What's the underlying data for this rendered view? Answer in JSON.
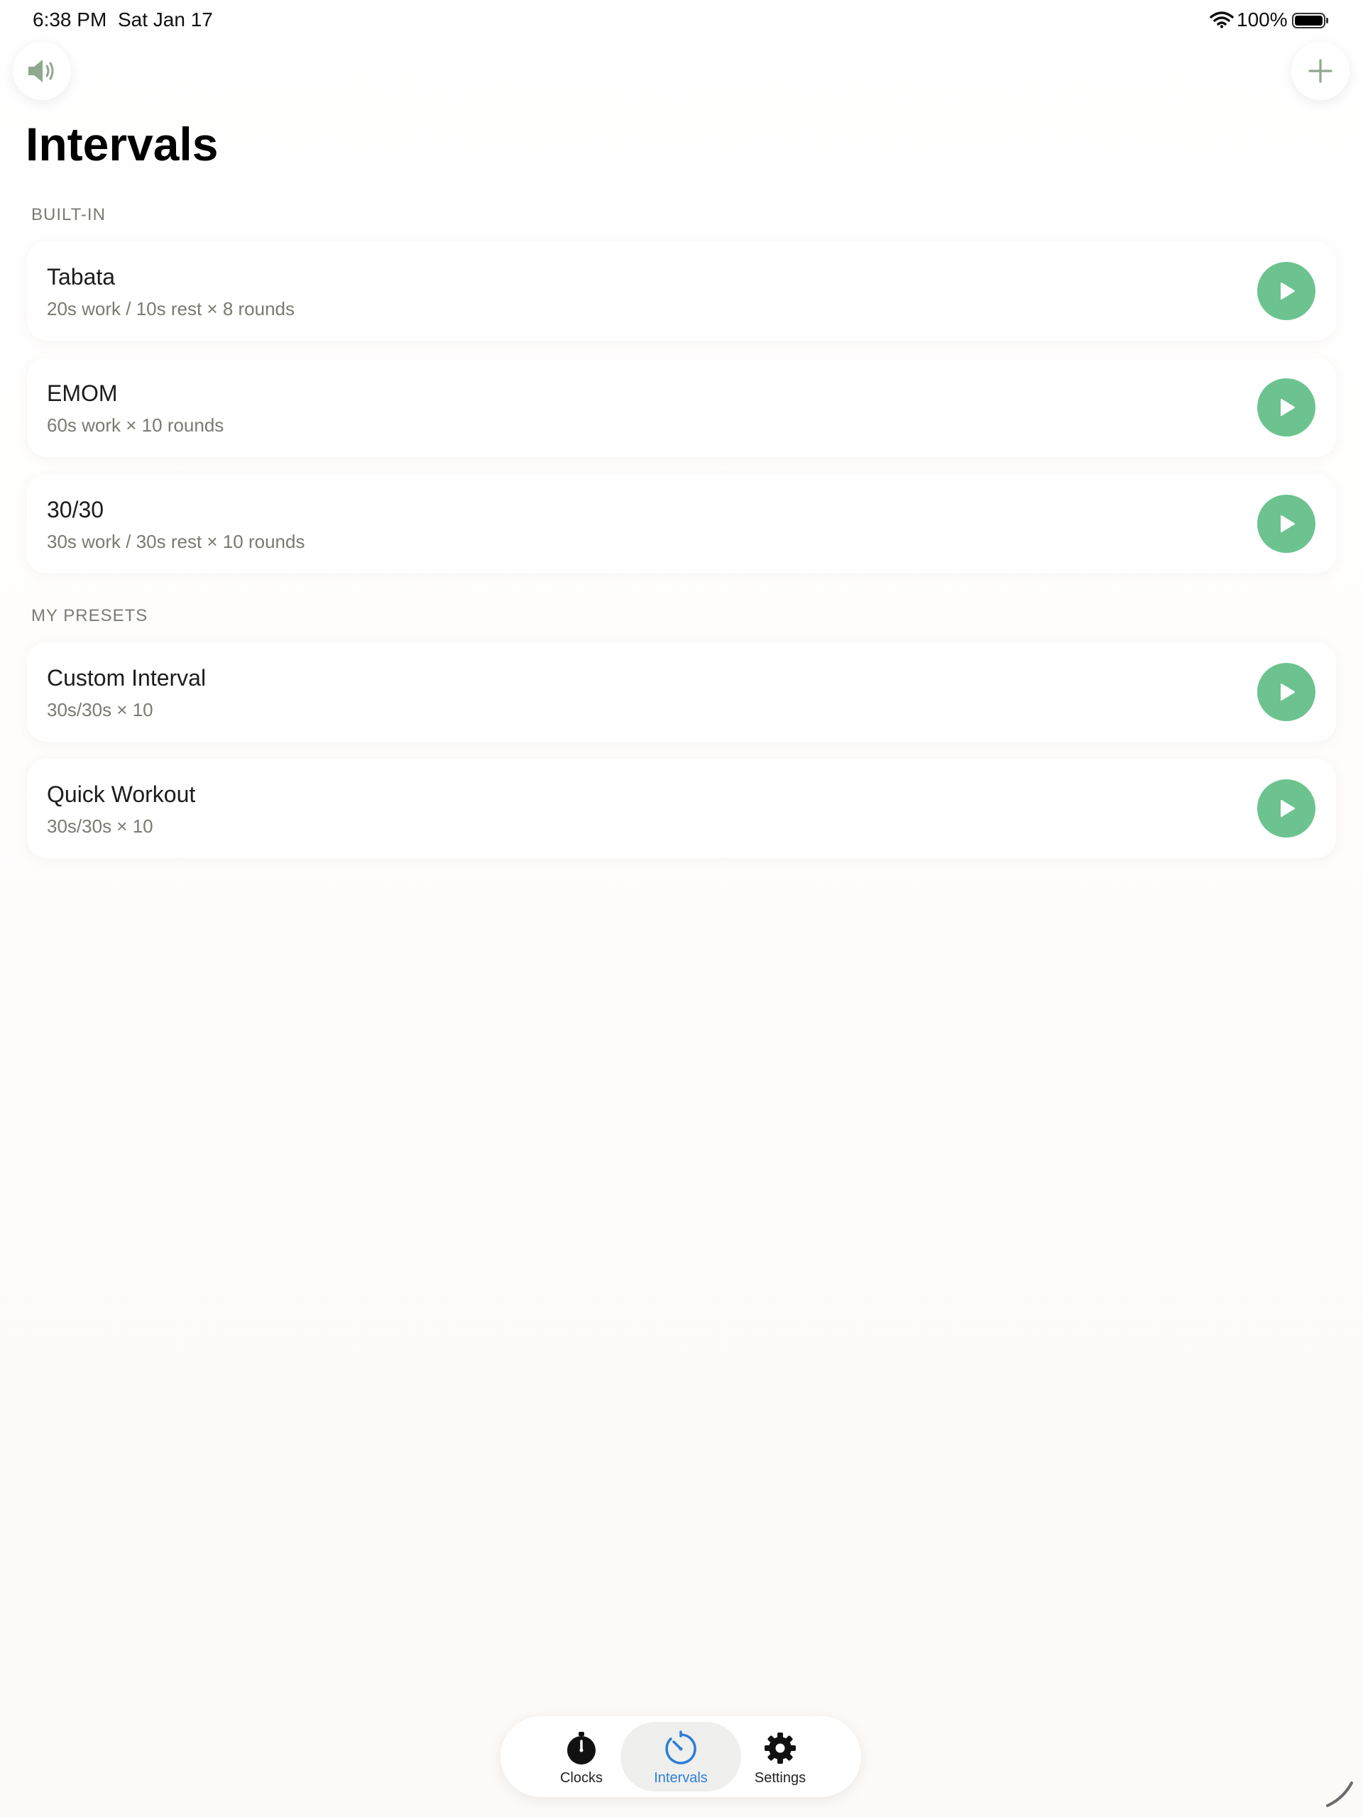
{
  "status_bar": {
    "time": "6:38 PM",
    "date": "Sat Jan 17",
    "battery_percent": "100%",
    "battery_level": 1.0
  },
  "header": {
    "sound_icon": "speaker-wave-icon",
    "add_icon": "plus-icon",
    "title": "Intervals"
  },
  "sections": {
    "builtin": {
      "label": "BUILT-IN",
      "items": [
        {
          "title": "Tabata",
          "subtitle": "20s work / 10s rest × 8 rounds"
        },
        {
          "title": "EMOM",
          "subtitle": "60s work × 10 rounds"
        },
        {
          "title": "30/30",
          "subtitle": "30s work / 30s rest × 10 rounds"
        }
      ]
    },
    "presets": {
      "label": "MY PRESETS",
      "items": [
        {
          "title": "Custom Interval",
          "subtitle": "30s/30s × 10"
        },
        {
          "title": "Quick Workout",
          "subtitle": "30s/30s × 10"
        }
      ]
    }
  },
  "tab_bar": {
    "tabs": [
      {
        "label": "Clocks",
        "icon": "stopwatch-icon",
        "active": false
      },
      {
        "label": "Intervals",
        "icon": "interval-timer-icon",
        "active": true
      },
      {
        "label": "Settings",
        "icon": "gear-icon",
        "active": false
      }
    ]
  },
  "colors": {
    "accent_green": "#6cc38f",
    "active_tab_blue": "#2f7fd4",
    "icon_green_gray": "#8fa88e"
  }
}
